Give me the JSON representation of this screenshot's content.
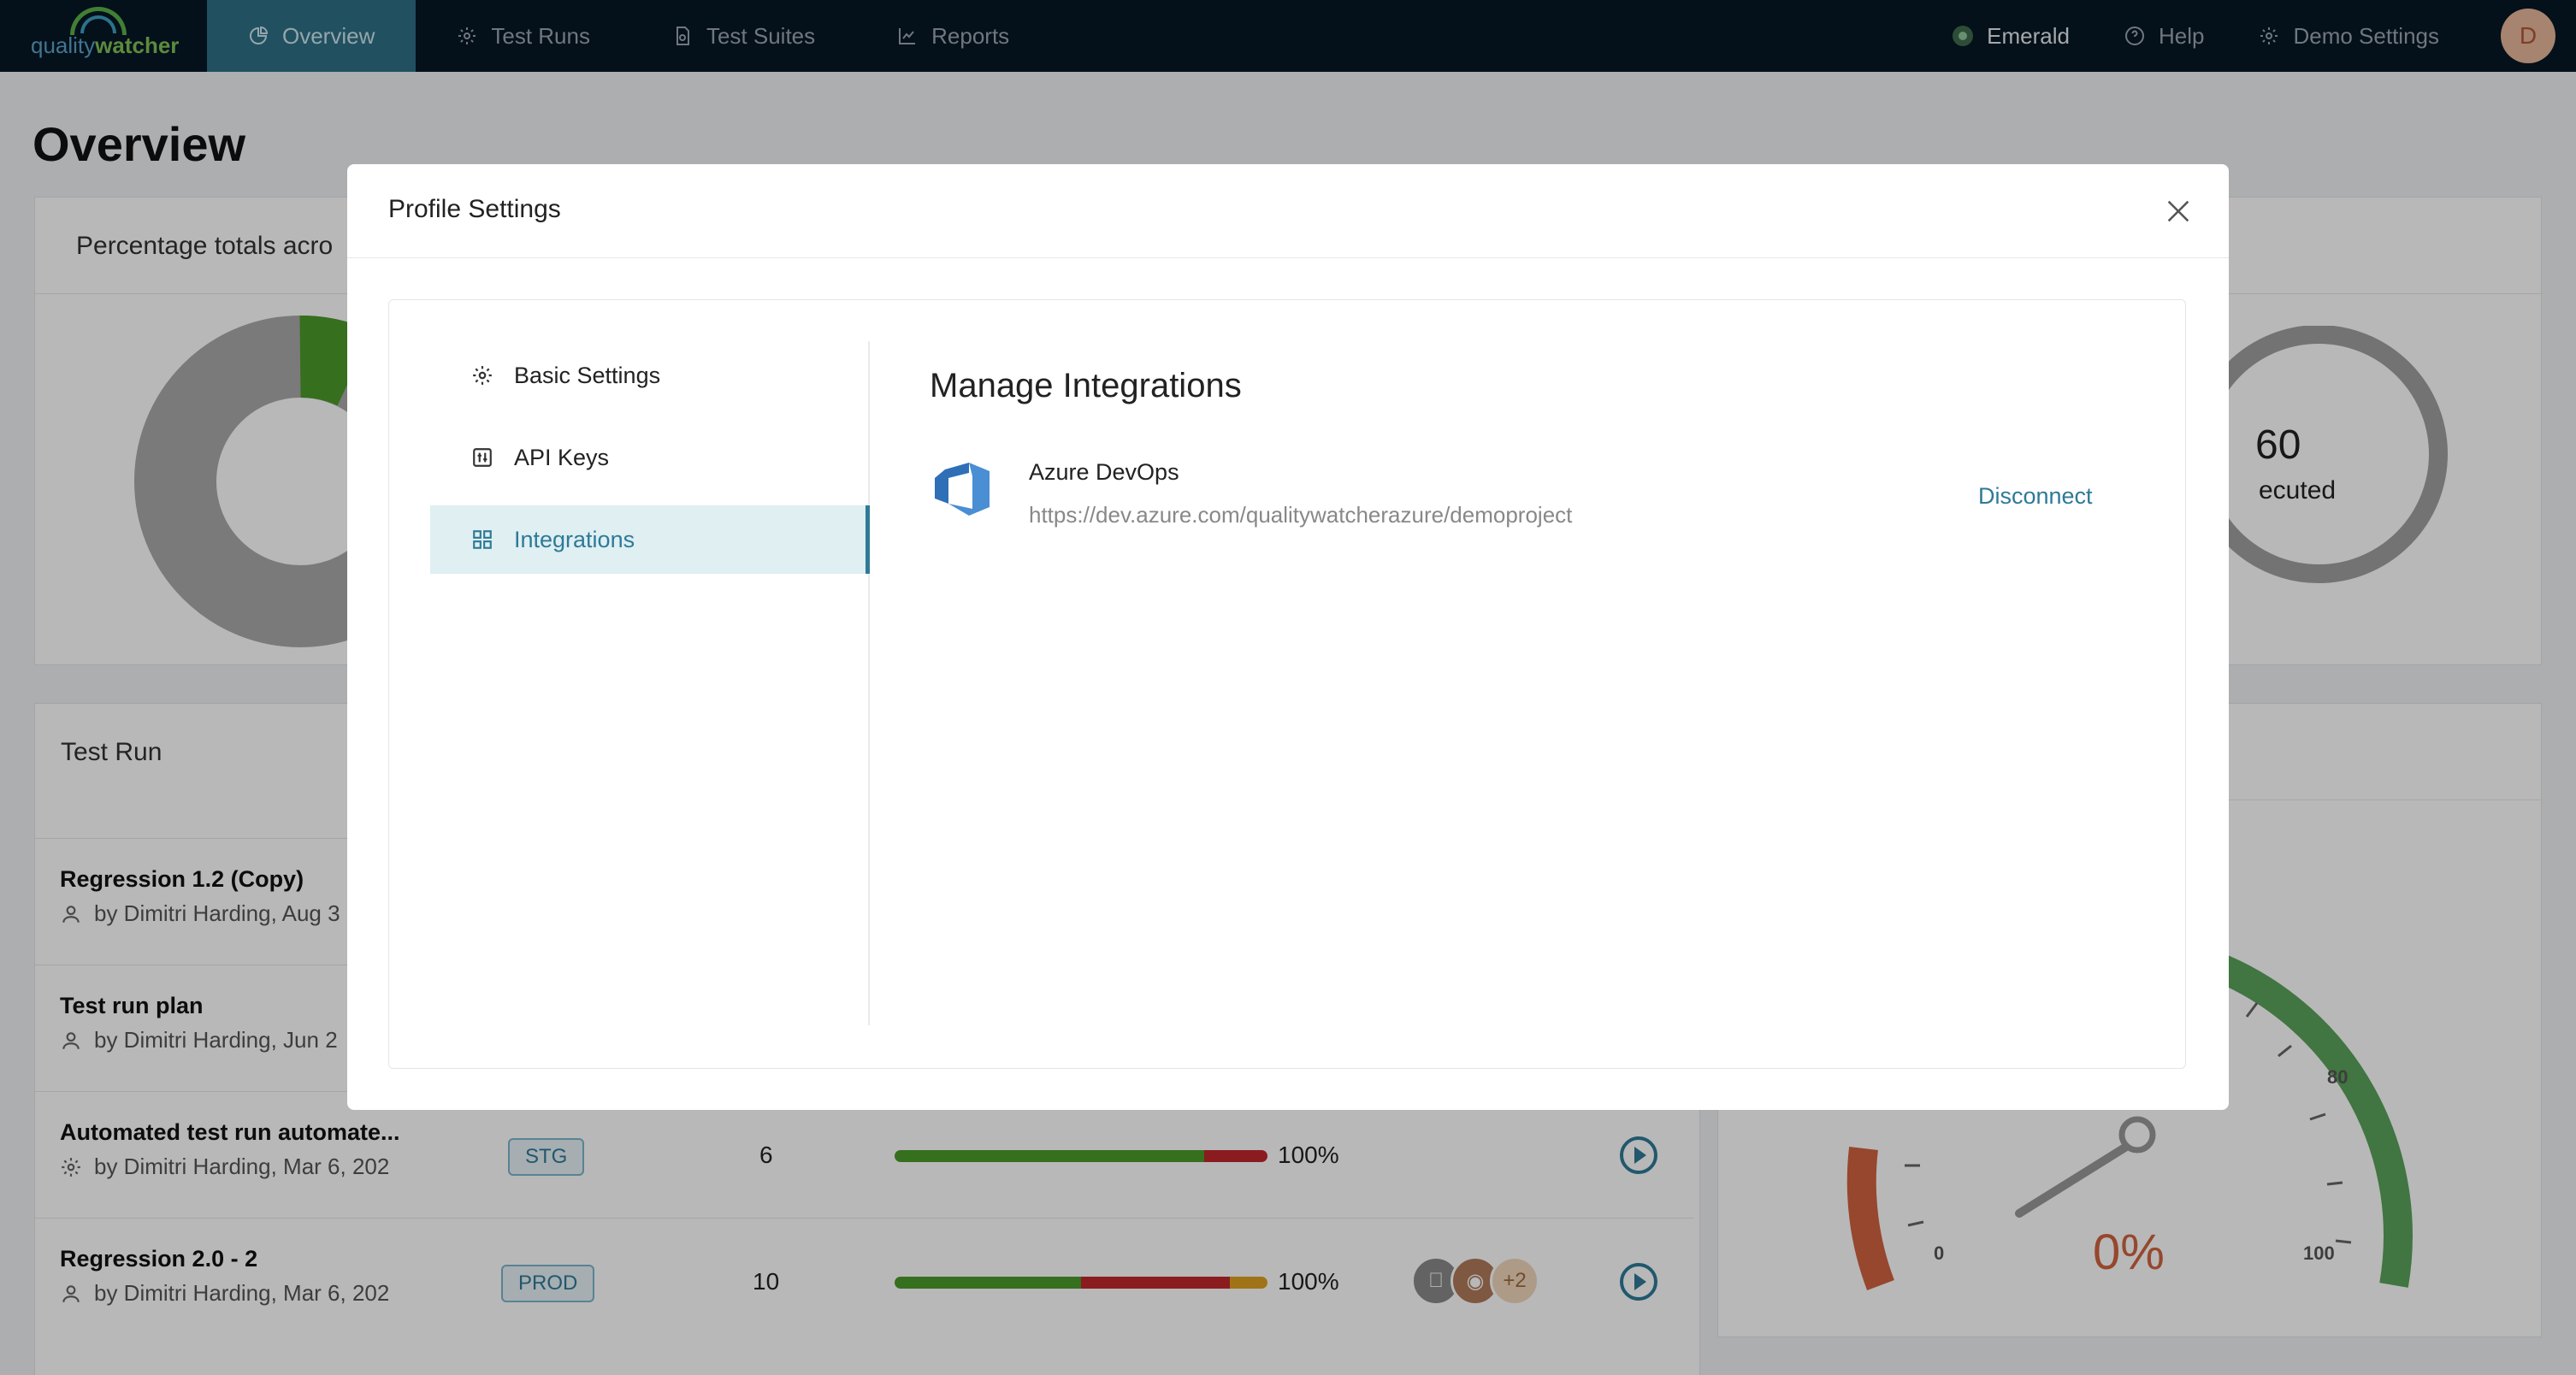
{
  "app": {
    "logo_text_1": "quality",
    "logo_text_2": "watcher"
  },
  "nav": {
    "items": [
      {
        "label": "Overview",
        "icon": "pie-chart-icon"
      },
      {
        "label": "Test Runs",
        "icon": "gear-icon"
      },
      {
        "label": "Test Suites",
        "icon": "document-icon"
      },
      {
        "label": "Reports",
        "icon": "line-chart-icon"
      }
    ],
    "environment": "Emerald",
    "help": "Help",
    "demo_settings": "Demo Settings",
    "avatar_initial": "D"
  },
  "page": {
    "title": "Overview",
    "percentage_card_title": "Percentage totals acro",
    "executed_value": "60",
    "executed_label": "ecuted",
    "test_run_card_title": "Test Run",
    "gauge": {
      "value": "0%",
      "ticks": [
        "0",
        "80",
        "100"
      ]
    }
  },
  "test_runs": [
    {
      "name": "Regression 1.2 (Copy)",
      "meta": "by Dimitri Harding, Aug 3",
      "icon": "user-icon"
    },
    {
      "name": "Test run plan",
      "meta": "by Dimitri Harding, Jun 2",
      "icon": "user-icon"
    },
    {
      "name": "Automated test run automate...",
      "meta": "by Dimitri Harding, Mar 6, 202",
      "icon": "gear-icon",
      "env": "STG",
      "count": "6",
      "pct": "100%",
      "bar": [
        {
          "fraction": 0.83,
          "color": "#4c9a2a"
        },
        {
          "fraction": 0.17,
          "color": "#c0282d"
        }
      ]
    },
    {
      "name": "Regression 2.0 - 2",
      "meta": "by Dimitri Harding, Mar 6, 202",
      "icon": "user-icon",
      "env": "PROD",
      "count": "10",
      "pct": "100%",
      "bar": [
        {
          "fraction": 0.5,
          "color": "#4c9a2a"
        },
        {
          "fraction": 0.4,
          "color": "#c0282d"
        },
        {
          "fraction": 0.1,
          "color": "#e0a020"
        }
      ],
      "extra_browsers": "+2"
    }
  ],
  "modal": {
    "title": "Profile Settings",
    "menu": [
      {
        "label": "Basic Settings",
        "icon": "gear-icon"
      },
      {
        "label": "API Keys",
        "icon": "key-icon"
      },
      {
        "label": "Integrations",
        "icon": "grid-icon"
      }
    ],
    "section_title": "Manage Integrations",
    "integration": {
      "name": "Azure DevOps",
      "url": "https://dev.azure.com/qualitywatcherazure/demoproject",
      "action": "Disconnect"
    }
  },
  "colors": {
    "accent": "#2e7a97",
    "nav_bg": "#061724",
    "pass": "#4c9a2a",
    "fail": "#c0282d",
    "skip": "#e0a020"
  }
}
